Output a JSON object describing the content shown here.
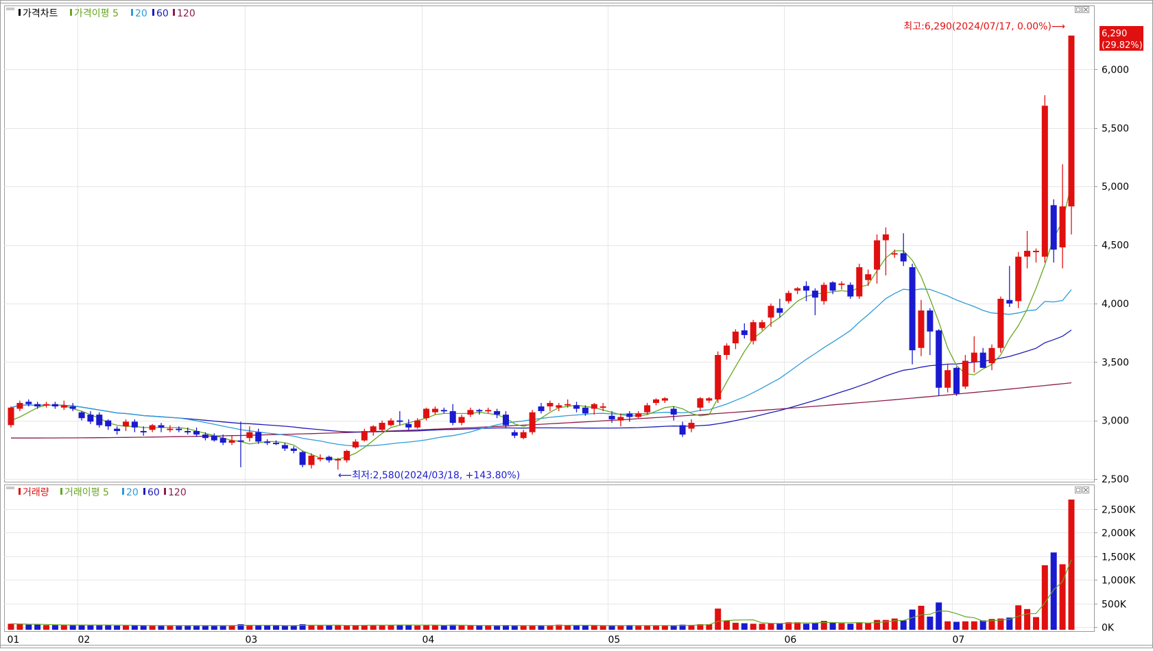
{
  "price_panel": {
    "legend": [
      {
        "label": "가격차트",
        "color": "#000000"
      },
      {
        "label": "가격이평 5",
        "color": "#66a61e"
      },
      {
        "label": "20",
        "color": "#2b9bd8"
      },
      {
        "label": "60",
        "color": "#1a1ab8"
      },
      {
        "label": "120",
        "color": "#8b1a4a"
      }
    ],
    "high_annotation": "최고:6,290(2024/07/17, 0.00%)⟶",
    "low_annotation": "⟵최저:2,580(2024/03/18, +143.80%)",
    "current_price_label": "6,290",
    "current_change_label": "(29.82%)",
    "y_tick_labels": [
      "6,000",
      "5,500",
      "5,000",
      "4,500",
      "4,000",
      "3,500",
      "3,000",
      "2,500"
    ]
  },
  "volume_panel": {
    "legend": [
      {
        "label": "거래량",
        "color": "#e01010"
      },
      {
        "label": "거래이평 5",
        "color": "#66a61e"
      },
      {
        "label": "20",
        "color": "#2b9bd8"
      },
      {
        "label": "60",
        "color": "#1a1ab8"
      },
      {
        "label": "120",
        "color": "#8b1a4a"
      }
    ],
    "y_tick_labels": [
      "2,500K",
      "2,000K",
      "1,500K",
      "1,000K",
      "500K",
      "0K"
    ]
  },
  "x_tick_labels": [
    "01",
    "02",
    "03",
    "04",
    "05",
    "06",
    "07"
  ],
  "colors": {
    "up": "#e01010",
    "down": "#1a1ad0",
    "grid": "#e6e6e6",
    "border": "#9a9a9a",
    "badge": "#e01010"
  },
  "chart_data": [
    {
      "type": "candlestick",
      "title": "가격차트",
      "ylim": [
        2500,
        6500
      ],
      "y_ticks": [
        2500,
        3000,
        3500,
        4000,
        4500,
        5000,
        5500,
        6000
      ],
      "x_month_starts": [
        {
          "label": "01",
          "index": 0
        },
        {
          "label": "02",
          "index": 8
        },
        {
          "label": "03",
          "index": 27
        },
        {
          "label": "04",
          "index": 47
        },
        {
          "label": "05",
          "index": 68
        },
        {
          "label": "06",
          "index": 88
        },
        {
          "label": "07",
          "index": 107
        }
      ],
      "candles": [
        [
          2960,
          3110,
          3120,
          2940
        ],
        [
          3100,
          3150,
          3170,
          3080
        ],
        [
          3160,
          3140,
          3180,
          3120
        ],
        [
          3140,
          3120,
          3160,
          3100
        ],
        [
          3130,
          3140,
          3160,
          3110
        ],
        [
          3140,
          3120,
          3160,
          3100
        ],
        [
          3110,
          3130,
          3170,
          3090
        ],
        [
          3120,
          3100,
          3150,
          3080
        ],
        [
          3070,
          3020,
          3080,
          3000
        ],
        [
          3050,
          2990,
          3080,
          2970
        ],
        [
          3050,
          2960,
          3070,
          2940
        ],
        [
          3000,
          2950,
          3010,
          2920
        ],
        [
          2930,
          2910,
          2950,
          2880
        ],
        [
          2950,
          2990,
          3010,
          2910
        ],
        [
          2990,
          2940,
          3010,
          2900
        ],
        [
          2910,
          2900,
          2950,
          2870
        ],
        [
          2920,
          2960,
          2970,
          2900
        ],
        [
          2960,
          2940,
          2980,
          2900
        ],
        [
          2920,
          2930,
          2960,
          2900
        ],
        [
          2930,
          2920,
          2950,
          2900
        ],
        [
          2910,
          2900,
          2940,
          2880
        ],
        [
          2910,
          2880,
          2940,
          2860
        ],
        [
          2880,
          2850,
          2900,
          2830
        ],
        [
          2870,
          2830,
          2890,
          2820
        ],
        [
          2850,
          2810,
          2880,
          2790
        ],
        [
          2810,
          2830,
          2870,
          2790
        ],
        [
          2830,
          2820,
          2990,
          2600
        ],
        [
          2850,
          2900,
          2950,
          2820
        ],
        [
          2900,
          2820,
          2930,
          2800
        ],
        [
          2820,
          2810,
          2840,
          2790
        ],
        [
          2810,
          2800,
          2830,
          2790
        ],
        [
          2790,
          2760,
          2810,
          2740
        ],
        [
          2760,
          2740,
          2780,
          2720
        ],
        [
          2730,
          2620,
          2740,
          2600
        ],
        [
          2620,
          2700,
          2720,
          2590
        ],
        [
          2680,
          2680,
          2710,
          2650
        ],
        [
          2690,
          2660,
          2700,
          2640
        ],
        [
          2660,
          2670,
          2680,
          2580
        ],
        [
          2660,
          2740,
          2750,
          2640
        ],
        [
          2770,
          2820,
          2840,
          2760
        ],
        [
          2830,
          2910,
          2930,
          2820
        ],
        [
          2900,
          2950,
          2960,
          2870
        ],
        [
          2920,
          2980,
          3000,
          2900
        ],
        [
          2960,
          3000,
          3020,
          2950
        ],
        [
          3000,
          2990,
          3080,
          2960
        ],
        [
          2970,
          2940,
          3010,
          2920
        ],
        [
          2940,
          3000,
          3020,
          2930
        ],
        [
          3020,
          3100,
          3110,
          3000
        ],
        [
          3070,
          3100,
          3120,
          3050
        ],
        [
          3090,
          3080,
          3110,
          3060
        ],
        [
          3080,
          2980,
          3140,
          2960
        ],
        [
          2980,
          3030,
          3050,
          2960
        ],
        [
          3050,
          3090,
          3110,
          3030
        ],
        [
          3090,
          3080,
          3100,
          3050
        ],
        [
          3080,
          3090,
          3110,
          3060
        ],
        [
          3080,
          3050,
          3100,
          3020
        ],
        [
          3050,
          2960,
          3080,
          2940
        ],
        [
          2900,
          2870,
          2920,
          2850
        ],
        [
          2850,
          2900,
          2920,
          2840
        ],
        [
          2900,
          3070,
          3090,
          2880
        ],
        [
          3120,
          3080,
          3150,
          3060
        ],
        [
          3120,
          3150,
          3170,
          3080
        ],
        [
          3110,
          3130,
          3150,
          3080
        ],
        [
          3140,
          3140,
          3180,
          3110
        ],
        [
          3130,
          3100,
          3160,
          3070
        ],
        [
          3110,
          3060,
          3130,
          3040
        ],
        [
          3100,
          3140,
          3150,
          3050
        ],
        [
          3110,
          3120,
          3150,
          3080
        ],
        [
          3040,
          3010,
          3080,
          2980
        ],
        [
          3000,
          3030,
          3060,
          2950
        ],
        [
          3060,
          3030,
          3080,
          2990
        ],
        [
          3030,
          3060,
          3080,
          3020
        ],
        [
          3070,
          3130,
          3150,
          3050
        ],
        [
          3150,
          3180,
          3190,
          3130
        ],
        [
          3170,
          3190,
          3200,
          3150
        ],
        [
          3100,
          3050,
          3120,
          3000
        ],
        [
          2960,
          2880,
          2990,
          2860
        ],
        [
          2930,
          2980,
          3010,
          2900
        ],
        [
          3110,
          3190,
          3200,
          3080
        ],
        [
          3170,
          3190,
          3200,
          3150
        ],
        [
          3180,
          3560,
          3590,
          3150
        ],
        [
          3560,
          3640,
          3660,
          3520
        ],
        [
          3660,
          3760,
          3780,
          3610
        ],
        [
          3770,
          3730,
          3830,
          3700
        ],
        [
          3680,
          3840,
          3860,
          3650
        ],
        [
          3790,
          3840,
          3860,
          3770
        ],
        [
          3880,
          3980,
          4000,
          3800
        ],
        [
          3960,
          3920,
          4040,
          3880
        ],
        [
          4020,
          4090,
          4110,
          4000
        ],
        [
          4110,
          4130,
          4140,
          4080
        ],
        [
          4150,
          4110,
          4190,
          4020
        ],
        [
          4110,
          4050,
          4130,
          3900
        ],
        [
          4020,
          4160,
          4180,
          3990
        ],
        [
          4180,
          4110,
          4190,
          4080
        ],
        [
          4160,
          4170,
          4190,
          4120
        ],
        [
          4160,
          4060,
          4180,
          4040
        ],
        [
          4060,
          4310,
          4340,
          4040
        ],
        [
          4200,
          4250,
          4290,
          4150
        ],
        [
          4290,
          4540,
          4590,
          4170
        ],
        [
          4540,
          4590,
          4650,
          4240
        ],
        [
          4430,
          4430,
          4460,
          4390
        ],
        [
          4430,
          4360,
          4600,
          4320
        ],
        [
          4310,
          3600,
          4340,
          3480
        ],
        [
          3620,
          3940,
          4030,
          3550
        ],
        [
          3940,
          3760,
          3960,
          3560
        ],
        [
          3770,
          3280,
          3780,
          3210
        ],
        [
          3280,
          3430,
          3480,
          3240
        ],
        [
          3450,
          3230,
          3460,
          3210
        ],
        [
          3290,
          3510,
          3560,
          3270
        ],
        [
          3500,
          3580,
          3720,
          3410
        ],
        [
          3580,
          3450,
          3620,
          3450
        ],
        [
          3490,
          3620,
          3650,
          3430
        ],
        [
          3620,
          4040,
          4060,
          3580
        ],
        [
          4030,
          4000,
          4320,
          3970
        ],
        [
          4020,
          4400,
          4440,
          3960
        ],
        [
          4400,
          4450,
          4620,
          4300
        ],
        [
          4450,
          4450,
          4470,
          4350
        ],
        [
          4400,
          5690,
          5780,
          4350
        ],
        [
          4840,
          4460,
          4890,
          4350
        ],
        [
          4480,
          4830,
          5190,
          4300
        ],
        [
          4830,
          6290,
          6290,
          4590
        ]
      ],
      "ma5": [
        3000,
        3030,
        3070,
        3110,
        3130,
        3130,
        3130,
        3100,
        3080,
        3050,
        3020,
        2980,
        2960,
        2950,
        2950,
        2940,
        2940,
        2940,
        2940,
        2940,
        2930,
        2910,
        2890,
        2870,
        2850,
        2830,
        2820,
        2800,
        2810,
        2820,
        2820,
        2810,
        2790,
        2740,
        2710,
        2680,
        2670,
        2670,
        2690,
        2720,
        2770,
        2830,
        2890,
        2940,
        2960,
        2980,
        3000,
        3020,
        3050,
        3060,
        3060,
        3060,
        3060,
        3070,
        3060,
        3050,
        3020,
        2970,
        2950,
        2970,
        3020,
        3070,
        3110,
        3120,
        3130,
        3120,
        3110,
        3090,
        3070,
        3050,
        3040,
        3040,
        3050,
        3080,
        3110,
        3120,
        3100,
        3060,
        3040,
        3050,
        3190,
        3330,
        3460,
        3590,
        3700,
        3760,
        3830,
        3880,
        3950,
        4020,
        4060,
        4080,
        4090,
        4100,
        4110,
        4100,
        4140,
        4160,
        4280,
        4390,
        4450,
        4450,
        4370,
        4230,
        4040,
        3840,
        3620,
        3470,
        3400,
        3390,
        3440,
        3480,
        3560,
        3700,
        3810,
        3950,
        4130,
        4330,
        4560,
        4700,
        5020
      ]
    },
    {
      "type": "bar",
      "title": "거래량",
      "unit": "K",
      "ylim": [
        0,
        2800
      ],
      "y_ticks": [
        0,
        500,
        1000,
        1500,
        2000,
        2500
      ],
      "volume_k": [
        70,
        60,
        50,
        50,
        40,
        40,
        40,
        40,
        50,
        40,
        40,
        40,
        30,
        40,
        30,
        30,
        30,
        30,
        30,
        30,
        30,
        30,
        30,
        30,
        30,
        30,
        60,
        30,
        30,
        30,
        30,
        30,
        30,
        60,
        40,
        30,
        30,
        40,
        30,
        40,
        40,
        40,
        40,
        40,
        50,
        40,
        30,
        40,
        40,
        30,
        50,
        30,
        30,
        30,
        30,
        30,
        40,
        30,
        30,
        30,
        30,
        30,
        50,
        40,
        30,
        30,
        30,
        30,
        30,
        30,
        40,
        30,
        30,
        30,
        30,
        30,
        50,
        40,
        60,
        60,
        390,
        130,
        90,
        80,
        70,
        70,
        80,
        80,
        100,
        100,
        70,
        80,
        130,
        90,
        80,
        70,
        100,
        80,
        150,
        150,
        180,
        140,
        370,
        450,
        220,
        520,
        120,
        110,
        120,
        120,
        140,
        170,
        180,
        200,
        460,
        380,
        210,
        1310,
        1580,
        1330,
        2700
      ]
    }
  ]
}
